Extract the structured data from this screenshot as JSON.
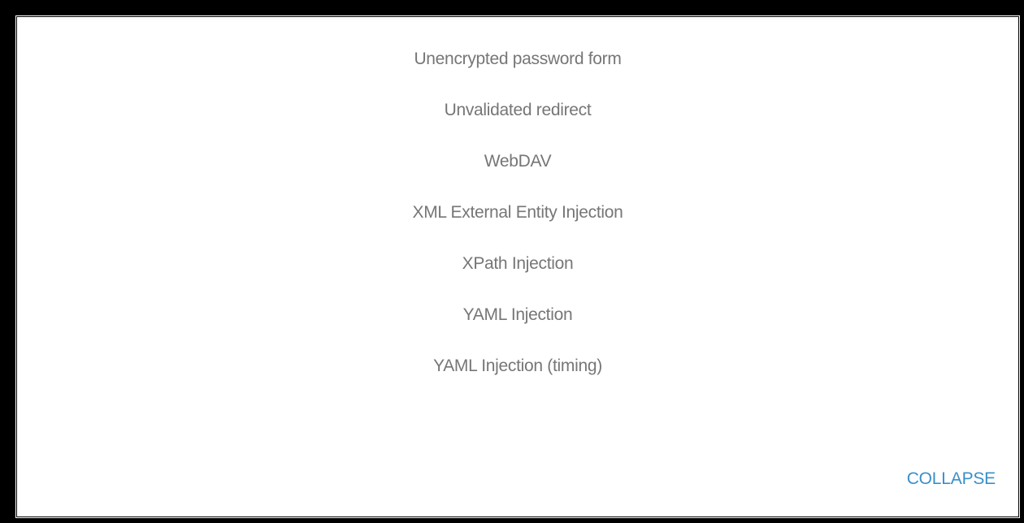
{
  "vulnerability_list": {
    "items": [
      "Unencrypted password form",
      "Unvalidated redirect",
      "WebDAV",
      "XML External Entity Injection",
      "XPath Injection",
      "YAML Injection",
      "YAML Injection (timing)"
    ]
  },
  "controls": {
    "collapse_label": "COLLAPSE"
  },
  "colors": {
    "item_text": "#767676",
    "accent": "#3a8fc9",
    "background": "#ffffff",
    "frame": "#000000"
  }
}
